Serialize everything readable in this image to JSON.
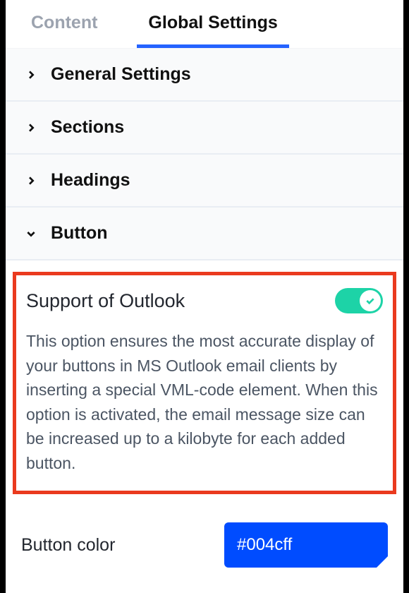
{
  "tabs": {
    "content": "Content",
    "global": "Global Settings"
  },
  "accordion": {
    "general": "General Settings",
    "sections": "Sections",
    "headings": "Headings",
    "button": "Button"
  },
  "outlook": {
    "title": "Support of Outlook",
    "description": "This option ensures the most accurate display of your buttons in MS Outlook email clients by inserting a special VML-code element. When this option is activated, the email message size can be increased up to a kilobyte for each added button.",
    "enabled": true
  },
  "buttonColor": {
    "label": "Button color",
    "value": "#004cff"
  }
}
